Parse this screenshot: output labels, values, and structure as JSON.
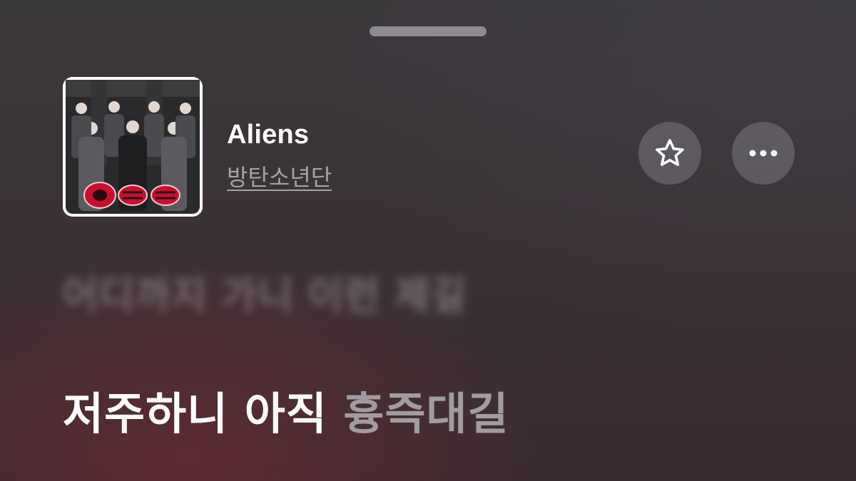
{
  "player": {
    "song_title": "Aliens",
    "artist": "방탄소년단",
    "favorite_icon": "star-icon",
    "more_icon": "ellipsis-icon",
    "artwork_icon": "album-artwork"
  },
  "lyrics": {
    "previous_line": "어디까지 가니 이런 제길",
    "current_line_sung": "저주하니 아직",
    "current_line_unsung": "흉즉대길"
  },
  "colors": {
    "background_top": "#3b383c",
    "background_bottom": "#3a2c31",
    "sung_text": "#ffffff",
    "unsung_text": "#a19ca1",
    "artist_text": "#a7a2a6"
  }
}
